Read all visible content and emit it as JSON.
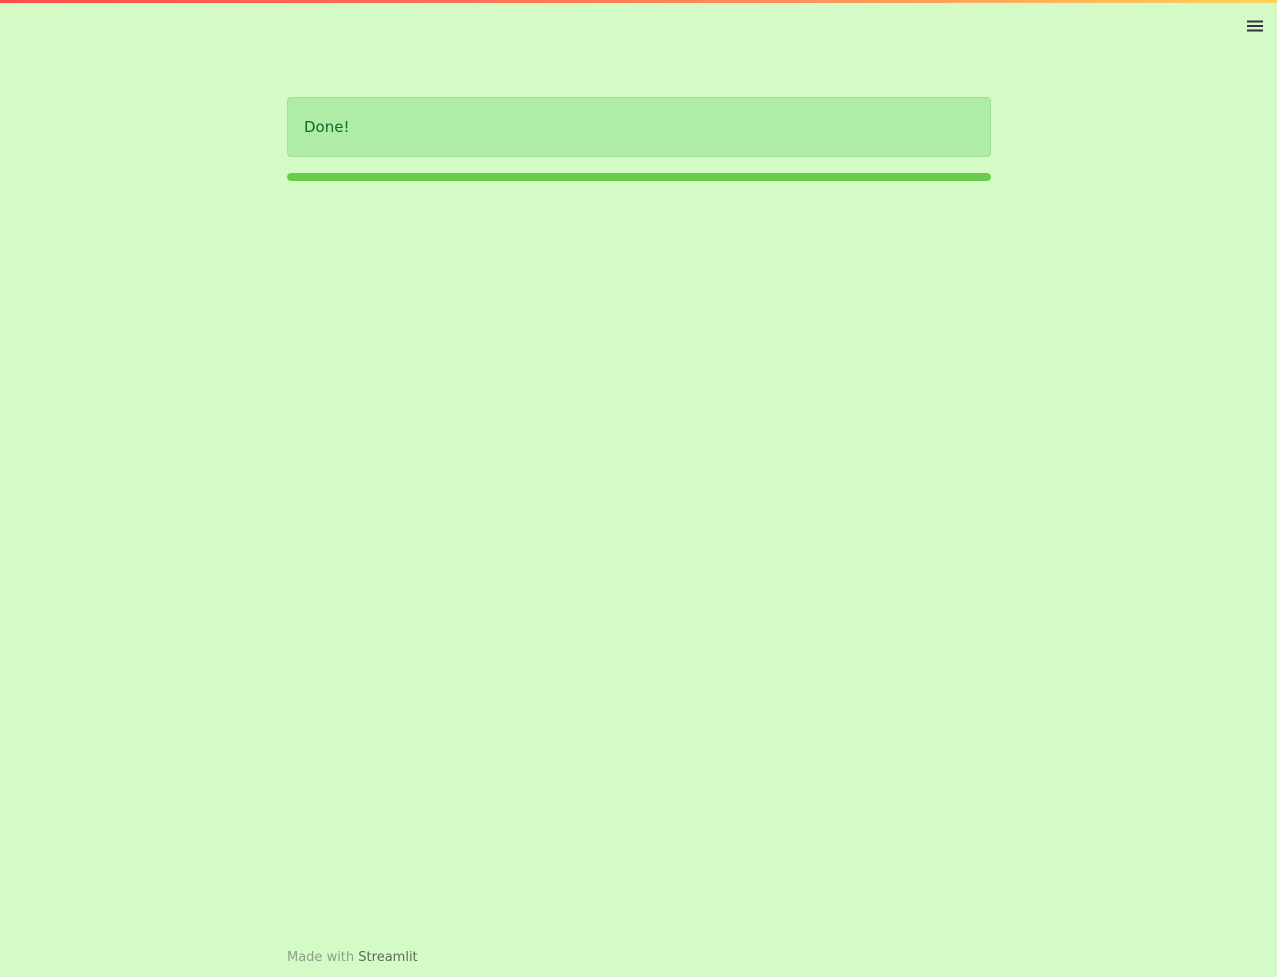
{
  "header": {
    "menu_icon": "hamburger-menu-icon",
    "decoration_colors": [
      "#ff4b4b",
      "#ff8c5a",
      "#ffd35c"
    ]
  },
  "main": {
    "alert": {
      "type": "success",
      "text": "Done!",
      "background_color": "#aeeca8",
      "text_color": "#0b6b2d"
    },
    "progress": {
      "value": 1.0,
      "fill_color": "#6bcb4b"
    }
  },
  "footer": {
    "prefix": "Made with",
    "brand": "Streamlit"
  },
  "theme": {
    "background_color": "#d4fbc6"
  }
}
